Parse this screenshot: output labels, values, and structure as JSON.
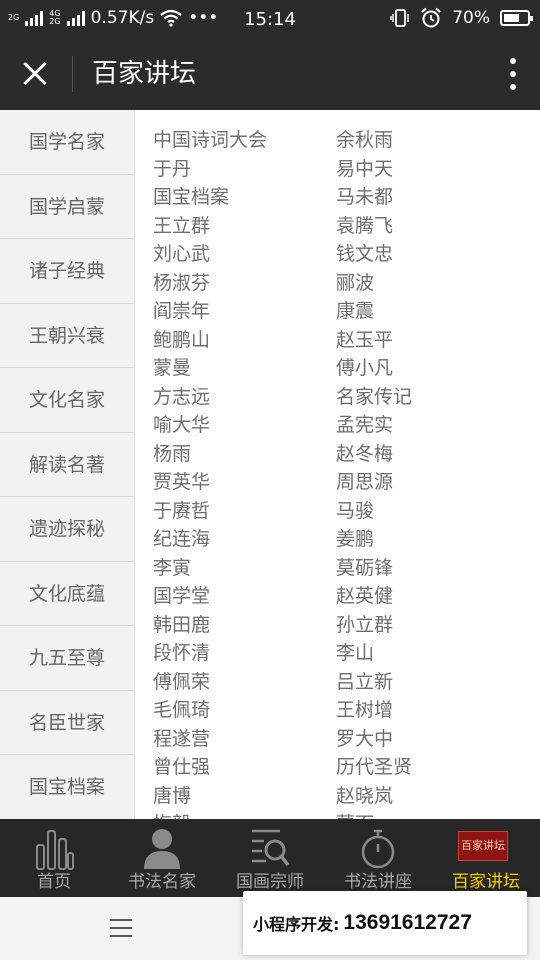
{
  "status_bar": {
    "network_top": "2G",
    "network_4g": "4G",
    "network_2g": "2G",
    "speed": "0.57K/s",
    "more": "•••",
    "time": "15:14",
    "battery_percent": "70%",
    "battery_level": 0.7
  },
  "title_bar": {
    "title": "百家讲坛"
  },
  "categories": [
    "国学名家",
    "国学启蒙",
    "诸子经典",
    "王朝兴衰",
    "文化名家",
    "解读名著",
    "遗迹探秘",
    "文化底蕴",
    "九五至尊",
    "名臣世家",
    "国宝档案"
  ],
  "content_items": [
    "中国诗词大会",
    "余秋雨",
    "于丹",
    "易中天",
    "国宝档案",
    "马未都",
    "王立群",
    "袁腾飞",
    "刘心武",
    "钱文忠",
    "杨淑芬",
    "郦波",
    "阎崇年",
    "康震",
    "鲍鹏山",
    "赵玉平",
    "蒙曼",
    "傅小凡",
    "方志远",
    "名家传记",
    "喻大华",
    "孟宪实",
    "杨雨",
    "赵冬梅",
    "贾英华",
    "周思源",
    "于赓哲",
    "马骏",
    "纪连海",
    "姜鹏",
    "李寅",
    "莫砺锋",
    "国学堂",
    "赵英健",
    "韩田鹿",
    "孙立群",
    "段怀清",
    "李山",
    "傅佩荣",
    "吕立新",
    "毛佩琦",
    "王树增",
    "程遂营",
    "罗大中",
    "曾仕强",
    "历代圣贤",
    "唐博",
    "赵晓岚",
    "梅毅",
    "蒙面"
  ],
  "tabs": [
    {
      "label": "首页",
      "icon": "bar-chart-icon"
    },
    {
      "label": "书法名家",
      "icon": "person-icon"
    },
    {
      "label": "国画宗师",
      "icon": "search-list-icon"
    },
    {
      "label": "书法讲座",
      "icon": "stopwatch-icon"
    },
    {
      "label": "百家讲坛",
      "icon": "logo-image",
      "logo_text": "百家讲坛"
    }
  ],
  "ad": {
    "label": "小程序开发:",
    "phone": "13691612727"
  },
  "colors": {
    "dark_bar": "#2b2b2b",
    "menu_bg": "#f2f2f2",
    "text_gray": "#6e6e6e",
    "active_tab": "#f5d000"
  }
}
